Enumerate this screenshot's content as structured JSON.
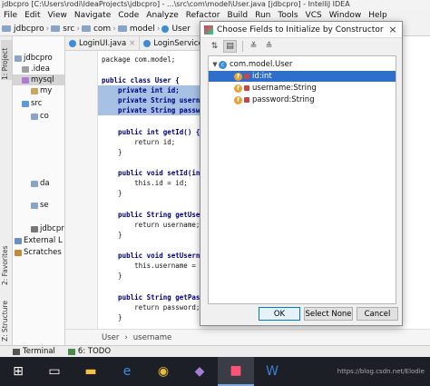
{
  "window": {
    "title": "jdbcpro [C:\\Users\\rodi\\IdeaProjects\\jdbcpro] - ...\\src\\com\\model\\User.java [jdbcpro] - IntelliJ IDEA"
  },
  "menu": [
    "File",
    "Edit",
    "View",
    "Navigate",
    "Code",
    "Analyze",
    "Refactor",
    "Build",
    "Run",
    "Tools",
    "VCS",
    "Window",
    "Help"
  ],
  "nav": [
    "jdbcpro",
    "src",
    "com",
    "model",
    "User"
  ],
  "side_tabs": {
    "project": "1: Project",
    "favorites": "2: Favorites",
    "structure": "Z: Structure"
  },
  "project_tree": [
    {
      "label": "jdbcpro"
    },
    {
      "label": ".idea"
    },
    {
      "label": "mysql"
    },
    {
      "label": "my"
    },
    {
      "label": "src"
    },
    {
      "label": "co"
    },
    {
      "label": "da"
    },
    {
      "label": "se"
    },
    {
      "label": "jdbcpr"
    },
    {
      "label": "External L"
    },
    {
      "label": "Scratches"
    }
  ],
  "editor_tabs": [
    {
      "label": "LoginUI.java"
    },
    {
      "label": "LoginServiceImpl.ja"
    }
  ],
  "code_lines": [
    {
      "text": "package com.model;"
    },
    {
      "text": "public class User {"
    },
    {
      "text": "    private int id;"
    },
    {
      "text": "    private String username;"
    },
    {
      "text": "    private String password;"
    },
    {
      "text": "    public int getId() {"
    },
    {
      "text": "        return id;"
    },
    {
      "text": "    }"
    },
    {
      "text": "    public void setId(int id)"
    },
    {
      "text": "        this.id = id;"
    },
    {
      "text": "    }"
    },
    {
      "text": "    public String getUsername("
    },
    {
      "text": "        return username;"
    },
    {
      "text": "    }"
    },
    {
      "text": "    public void setUsername(S"
    },
    {
      "text": "        this.username = userna"
    },
    {
      "text": "    }"
    },
    {
      "text": "    public String getPassword("
    },
    {
      "text": "        return password;"
    },
    {
      "text": "    }"
    }
  ],
  "breadcrumb_bottom": [
    "User",
    "username"
  ],
  "bottom_tools": [
    {
      "label": "Terminal"
    },
    {
      "label": "6: TODO"
    }
  ],
  "dialog": {
    "title": "Choose Fields to Initialize by Constructor",
    "close": "×",
    "class_node": "com.model.User",
    "fields": [
      {
        "name": "id:int",
        "selected": true
      },
      {
        "name": "username:String",
        "selected": false
      },
      {
        "name": "password:String",
        "selected": false
      }
    ],
    "buttons": {
      "ok": "OK",
      "select_none": "Select None",
      "cancel": "Cancel"
    }
  },
  "taskbar": {
    "tray_text": "https://blog.csdn.net/Elodie"
  }
}
